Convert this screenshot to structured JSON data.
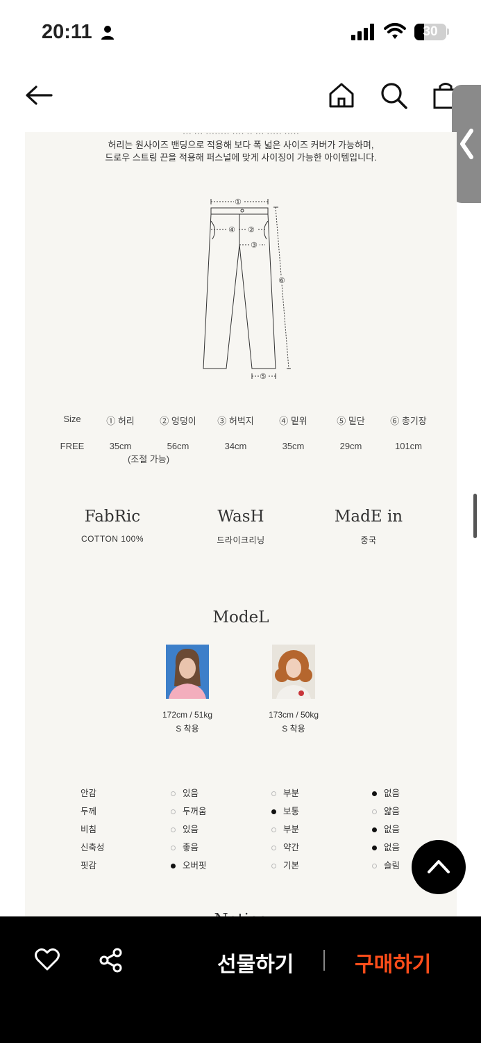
{
  "status_bar": {
    "time": "20:11",
    "battery": "30"
  },
  "intro": {
    "line1": "허리는 원사이즈 밴딩으로 적용해 보다 폭 넓은 사이즈 커버가 가능하며,",
    "line2": "드로우 스트링 끈을 적용해 퍼스널에 맞게 사이징이 가능한 아이템입니다."
  },
  "diagram_labels": [
    "①",
    "②",
    "③",
    "④",
    "⑤",
    "⑥"
  ],
  "size_table": {
    "headers": [
      "Size",
      "① 허리",
      "② 엉덩이",
      "③ 허벅지",
      "④ 밑위",
      "⑤ 밑단",
      "⑥ 총기장"
    ],
    "values": [
      "FREE",
      "35cm",
      "56cm",
      "34cm",
      "35cm",
      "29cm",
      "101cm"
    ],
    "note": "(조절 가능)"
  },
  "info": [
    {
      "title": "FabRic",
      "value": "COTTON 100%"
    },
    {
      "title": "WasH",
      "value": "드라이크리닝"
    },
    {
      "title": "MadE in",
      "value": "중국"
    }
  ],
  "model_section": {
    "title": "ModeL",
    "models": [
      {
        "size": "172cm / 51kg",
        "fit": "S 착용"
      },
      {
        "size": "173cm / 50kg",
        "fit": "S 착용"
      }
    ]
  },
  "attributes": [
    {
      "label": "안감",
      "options": [
        "있음",
        "부분",
        "없음"
      ],
      "selected": 2
    },
    {
      "label": "두께",
      "options": [
        "두꺼움",
        "보통",
        "얇음"
      ],
      "selected": 1
    },
    {
      "label": "비침",
      "options": [
        "있음",
        "부분",
        "없음"
      ],
      "selected": 2
    },
    {
      "label": "신축성",
      "options": [
        "좋음",
        "약간",
        "없음"
      ],
      "selected": 2
    },
    {
      "label": "핏감",
      "options": [
        "오버핏",
        "기본",
        "슬림"
      ],
      "selected": 0
    }
  ],
  "notice_title": "Notice",
  "bottom_bar": {
    "gift_label": "선물하기",
    "buy_label": "구매하기",
    "buy_color": "#ff4d1a"
  }
}
